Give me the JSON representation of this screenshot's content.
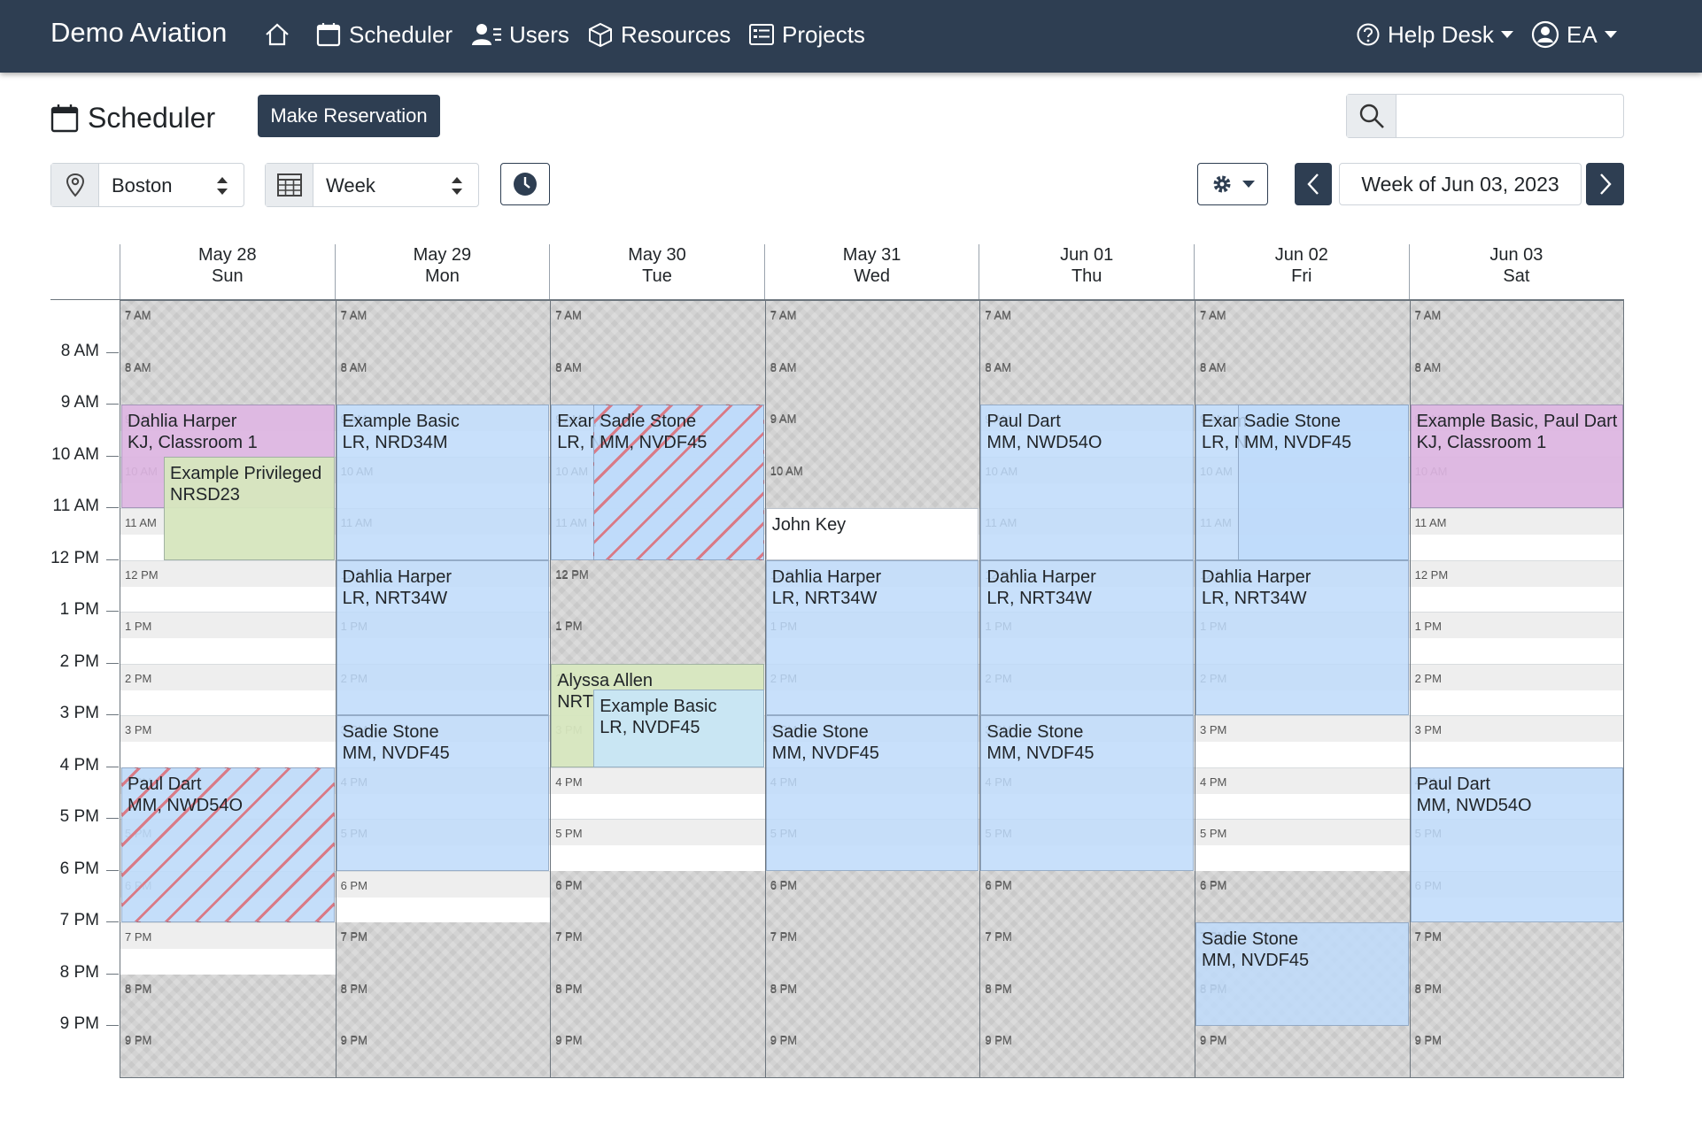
{
  "app": {
    "brand": "Demo Aviation"
  },
  "nav": {
    "scheduler": "Scheduler",
    "users": "Users",
    "resources": "Resources",
    "projects": "Projects",
    "help_desk": "Help Desk",
    "user_initials": "EA"
  },
  "toolbar": {
    "page_title": "Scheduler",
    "make_reservation": "Make Reservation",
    "search_placeholder": "",
    "location": "Boston",
    "view": "Week",
    "week_label": "Week of Jun 03, 2023"
  },
  "days": [
    {
      "date": "May 28",
      "weekday": "Sun"
    },
    {
      "date": "May 29",
      "weekday": "Mon"
    },
    {
      "date": "May 30",
      "weekday": "Tue"
    },
    {
      "date": "May 31",
      "weekday": "Wed"
    },
    {
      "date": "Jun 01",
      "weekday": "Thu"
    },
    {
      "date": "Jun 02",
      "weekday": "Fri"
    },
    {
      "date": "Jun 03",
      "weekday": "Sat"
    }
  ],
  "hours": [
    "8 AM",
    "9 AM",
    "10 AM",
    "11 AM",
    "12 PM",
    "1 PM",
    "2 PM",
    "3 PM",
    "4 PM",
    "5 PM",
    "6 PM",
    "7 PM",
    "8 PM",
    "9 PM"
  ],
  "slot_labels": [
    "7 AM",
    "8 AM",
    "9 AM",
    "10 AM",
    "11 AM",
    "12 PM",
    "1 PM",
    "2 PM",
    "3 PM",
    "4 PM",
    "5 PM",
    "6 PM",
    "7 PM",
    "8 PM",
    "9 PM"
  ],
  "events": [
    {
      "day": 0,
      "start": 9,
      "end": 11,
      "line1": "Dahlia Harper",
      "line2": "KJ, Classroom 1",
      "style": "pink"
    },
    {
      "day": 0,
      "start": 10,
      "end": 12,
      "line1": "Example Privileged",
      "line2": "NRSD23",
      "style": "green",
      "offset": 1
    },
    {
      "day": 0,
      "start": 16,
      "end": 19,
      "line1": "Paul Dart",
      "line2": "MM, NWD54O",
      "style": "hatch"
    },
    {
      "day": 1,
      "start": 9,
      "end": 12,
      "line1": "Example Basic",
      "line2": "LR, NRD34M",
      "style": "blue"
    },
    {
      "day": 1,
      "start": 12,
      "end": 15,
      "line1": "Dahlia Harper",
      "line2": "LR, NRT34W",
      "style": "blue"
    },
    {
      "day": 1,
      "start": 15,
      "end": 18,
      "line1": "Sadie Stone",
      "line2": "MM, NVDF45",
      "style": "blue"
    },
    {
      "day": 2,
      "start": 9,
      "end": 12,
      "line1": "Exam",
      "line2": "LR, N",
      "style": "blue"
    },
    {
      "day": 2,
      "start": 9,
      "end": 12,
      "line1": "Sadie Stone",
      "line2": "MM, NVDF45",
      "style": "hatch",
      "offset": 1
    },
    {
      "day": 2,
      "start": 14,
      "end": 16,
      "line1": "Alyssa Allen",
      "line2": "NRT",
      "style": "green"
    },
    {
      "day": 2,
      "start": 14.5,
      "end": 16,
      "line1": "Example Basic",
      "line2": "LR, NVDF45",
      "style": "lightblue",
      "offset": 1
    },
    {
      "day": 3,
      "start": 11,
      "end": 12,
      "line1": "John Key",
      "line2": "",
      "style": "white"
    },
    {
      "day": 3,
      "start": 12,
      "end": 15,
      "line1": "Dahlia Harper",
      "line2": "LR, NRT34W",
      "style": "blue"
    },
    {
      "day": 3,
      "start": 15,
      "end": 18,
      "line1": "Sadie Stone",
      "line2": "MM, NVDF45",
      "style": "blue"
    },
    {
      "day": 4,
      "start": 9,
      "end": 12,
      "line1": "Paul Dart",
      "line2": "MM, NWD54O",
      "style": "blue"
    },
    {
      "day": 4,
      "start": 12,
      "end": 15,
      "line1": "Dahlia Harper",
      "line2": "LR, NRT34W",
      "style": "blue"
    },
    {
      "day": 4,
      "start": 15,
      "end": 18,
      "line1": "Sadie Stone",
      "line2": "MM, NVDF45",
      "style": "blue"
    },
    {
      "day": 5,
      "start": 9,
      "end": 12,
      "line1": "Exam",
      "line2": "LR, N",
      "style": "blue"
    },
    {
      "day": 5,
      "start": 9,
      "end": 12,
      "line1": "Sadie Stone",
      "line2": "MM, NVDF45",
      "style": "blue",
      "offset": 1
    },
    {
      "day": 5,
      "start": 12,
      "end": 15,
      "line1": "Dahlia Harper",
      "line2": "LR, NRT34W",
      "style": "blue"
    },
    {
      "day": 5,
      "start": 19,
      "end": 21,
      "line1": "Sadie Stone",
      "line2": "MM, NVDF45",
      "style": "blue"
    },
    {
      "day": 6,
      "start": 9,
      "end": 11,
      "line1": "Example Basic, Paul Dart",
      "line2": "KJ, Classroom 1",
      "style": "pink"
    },
    {
      "day": 6,
      "start": 16,
      "end": 19,
      "line1": "Paul Dart",
      "line2": "MM, NWD54O",
      "style": "blue"
    }
  ],
  "closed": [
    [
      [
        7,
        9
      ],
      [
        20,
        22
      ]
    ],
    [
      [
        7,
        9
      ],
      [
        19,
        22
      ]
    ],
    [
      [
        7,
        9
      ],
      [
        12,
        14
      ],
      [
        18,
        22
      ]
    ],
    [
      [
        7,
        11
      ],
      [
        18,
        22
      ]
    ],
    [
      [
        7,
        9
      ],
      [
        18,
        22
      ]
    ],
    [
      [
        7,
        9
      ],
      [
        18,
        19
      ],
      [
        19,
        22
      ]
    ],
    [
      [
        7,
        9
      ],
      [
        19,
        22
      ]
    ]
  ]
}
